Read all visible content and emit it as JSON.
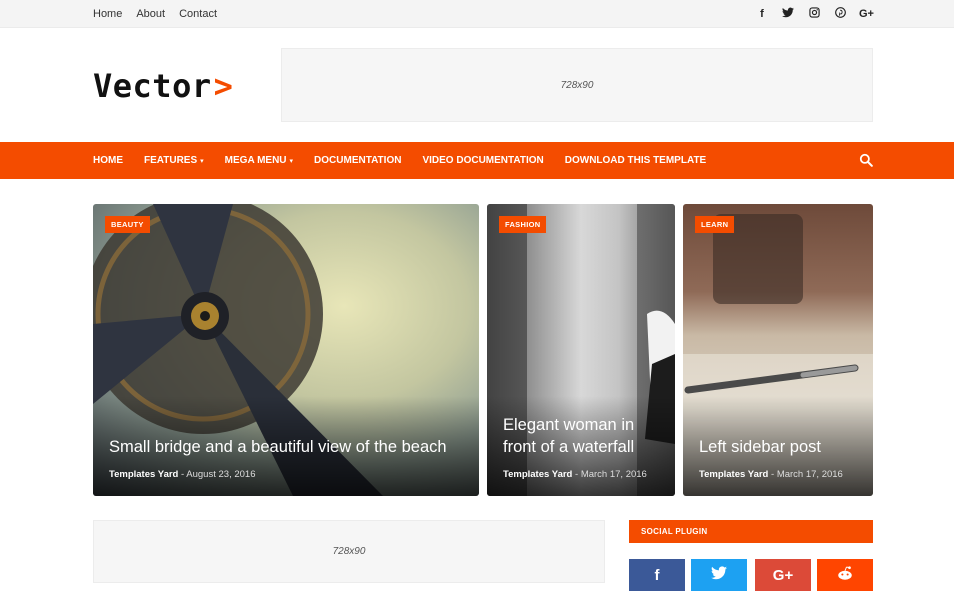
{
  "topbar": {
    "links": [
      "Home",
      "About",
      "Contact"
    ],
    "social_icons": [
      "facebook-icon",
      "twitter-icon",
      "instagram-icon",
      "pinterest-icon",
      "google-plus-icon"
    ],
    "social_glyphs": [
      "f",
      "t",
      "◎",
      "p",
      "G+"
    ]
  },
  "header": {
    "logo_word": "Vector",
    "logo_mark": ">",
    "ad_label": "728x90"
  },
  "nav": {
    "items": [
      "HOME",
      "FEATURES",
      "MEGA MENU",
      "DOCUMENTATION",
      "VIDEO DOCUMENTATION",
      "DOWNLOAD THIS TEMPLATE"
    ],
    "dropdown_indicator": "▾"
  },
  "featured": [
    {
      "tag": "BEAUTY",
      "title": "Small bridge and a beautiful view of the beach",
      "author": "Templates Yard",
      "date": "August 23, 2016"
    },
    {
      "tag": "FASHION",
      "title": "Elegant woman in front of a waterfall",
      "author": "Templates Yard",
      "date": "March 17, 2016"
    },
    {
      "tag": "LEARN",
      "title": "Left sidebar post",
      "author": "Templates Yard",
      "date": "March 17, 2016"
    }
  ],
  "bottom": {
    "ad_label": "728x90",
    "social_heading": "SOCIAL PLUGIN",
    "buttons": [
      {
        "icon": "facebook-icon",
        "glyph": "f",
        "color": "#3b5998"
      },
      {
        "icon": "twitter-icon",
        "glyph": "t",
        "color": "#1da1f2"
      },
      {
        "icon": "google-plus-icon",
        "glyph": "G+",
        "color": "#dc4a38"
      },
      {
        "icon": "reddit-icon",
        "glyph": "☻",
        "color": "#ff4500"
      }
    ]
  },
  "colors": {
    "accent": "#f44c00"
  }
}
